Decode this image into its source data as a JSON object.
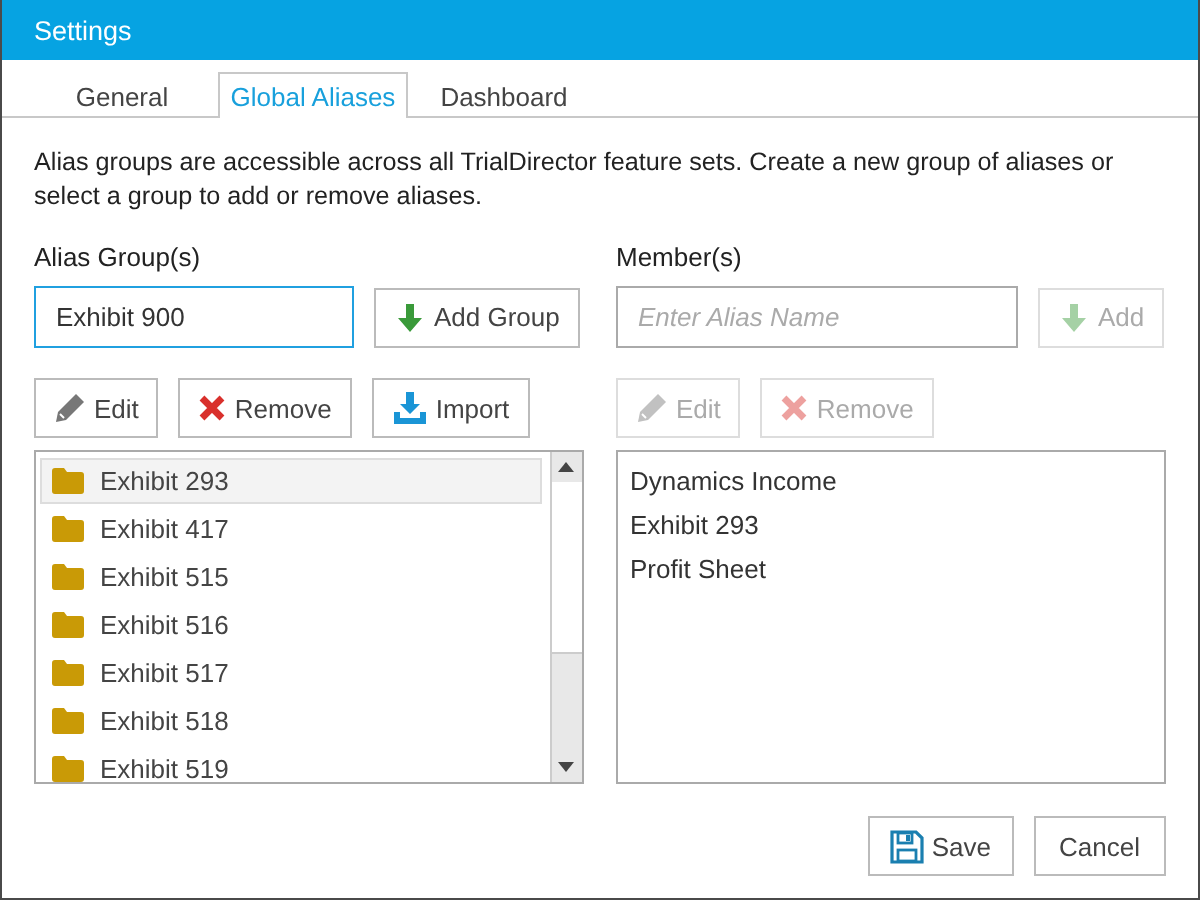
{
  "window": {
    "title": "Settings"
  },
  "tabs": [
    {
      "label": "General",
      "selected": false
    },
    {
      "label": "Global Aliases",
      "selected": true
    },
    {
      "label": "Dashboard",
      "selected": false
    }
  ],
  "description": "Alias groups are accessible across all TrialDirector feature sets. Create a new group of aliases or select a group to add or remove aliases.",
  "alias_groups": {
    "label": "Alias Group(s)",
    "input": {
      "value": "Exhibit 900"
    },
    "add_button": {
      "label": "Add Group",
      "kind": "add",
      "disabled": false
    },
    "actions": [
      {
        "label": "Edit",
        "kind": "edit",
        "disabled": false
      },
      {
        "label": "Remove",
        "kind": "remove",
        "disabled": false
      },
      {
        "label": "Import",
        "kind": "import",
        "disabled": false
      }
    ],
    "items": [
      {
        "label": "Exhibit 293",
        "selected": true
      },
      {
        "label": "Exhibit 417",
        "selected": false
      },
      {
        "label": "Exhibit 515",
        "selected": false
      },
      {
        "label": "Exhibit 516",
        "selected": false
      },
      {
        "label": "Exhibit 517",
        "selected": false
      },
      {
        "label": "Exhibit 518",
        "selected": false
      },
      {
        "label": "Exhibit 519",
        "selected": false
      }
    ]
  },
  "members": {
    "label": "Member(s)",
    "input": {
      "placeholder": "Enter Alias Name"
    },
    "add_button": {
      "label": "Add",
      "kind": "add",
      "disabled": true
    },
    "actions": [
      {
        "label": "Edit",
        "kind": "edit",
        "disabled": true
      },
      {
        "label": "Remove",
        "kind": "remove",
        "disabled": true
      }
    ],
    "items": [
      {
        "label": "Dynamics Income",
        "selected": false
      },
      {
        "label": "Exhibit 293",
        "selected": false
      },
      {
        "label": "Profit Sheet",
        "selected": false
      }
    ]
  },
  "footer_buttons": [
    {
      "label": "Save",
      "kind": "save"
    },
    {
      "label": "Cancel",
      "kind": "plain"
    }
  ]
}
